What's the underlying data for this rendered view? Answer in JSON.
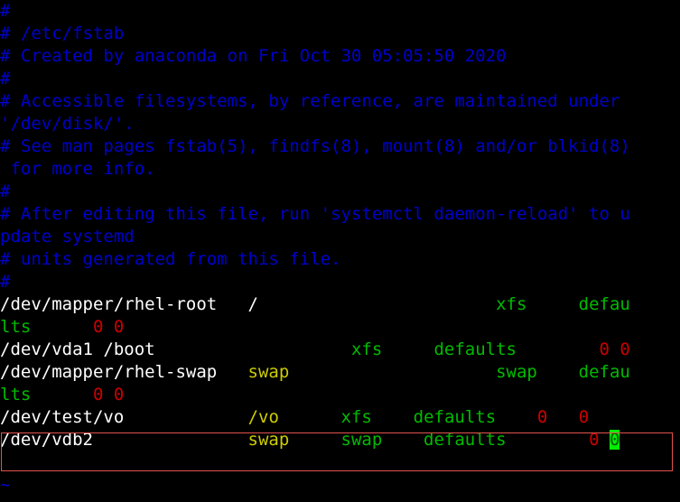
{
  "terminal": {
    "editor": "vim",
    "file": "/etc/fstab",
    "background_color": "#000000",
    "colors": {
      "comment": "#0000cc",
      "device": "#ffffff",
      "mount_point": "#cccc00",
      "fs_type": "#00bb00",
      "options": "#00bb00",
      "numbers": "#cc0000",
      "cursor_background": "#00ee00",
      "selection_border": "#e2524e"
    },
    "lines": [
      {
        "id": "line-1",
        "segments": [
          {
            "text": "#",
            "cls": "c-comment"
          }
        ]
      },
      {
        "id": "line-2",
        "segments": [
          {
            "text": "# /etc/fstab",
            "cls": "c-comment"
          }
        ]
      },
      {
        "id": "line-3",
        "segments": [
          {
            "text": "# Created by anaconda on Fri Oct 30 05:05:50 2020",
            "cls": "c-comment"
          }
        ]
      },
      {
        "id": "line-4",
        "segments": [
          {
            "text": "#",
            "cls": "c-comment"
          }
        ]
      },
      {
        "id": "line-5",
        "segments": [
          {
            "text": "# Accessible filesystems, by reference, are maintained under",
            "cls": "c-comment"
          }
        ]
      },
      {
        "id": "line-6",
        "segments": [
          {
            "text": "'/dev/disk/'.",
            "cls": "c-comment"
          }
        ]
      },
      {
        "id": "line-7",
        "segments": [
          {
            "text": "# See man pages fstab(5), findfs(8), mount(8) and/or blkid(8)",
            "cls": "c-comment"
          }
        ]
      },
      {
        "id": "line-8",
        "segments": [
          {
            "text": " for more info.",
            "cls": "c-comment"
          }
        ]
      },
      {
        "id": "line-9",
        "segments": [
          {
            "text": "#",
            "cls": "c-comment"
          }
        ]
      },
      {
        "id": "line-10",
        "segments": [
          {
            "text": "# After editing this file, run 'systemctl daemon-reload' to u",
            "cls": "c-comment"
          }
        ]
      },
      {
        "id": "line-11",
        "segments": [
          {
            "text": "pdate systemd",
            "cls": "c-comment"
          }
        ]
      },
      {
        "id": "line-12",
        "segments": [
          {
            "text": "# units generated from this file.",
            "cls": "c-comment"
          }
        ]
      },
      {
        "id": "line-13",
        "segments": [
          {
            "text": "#",
            "cls": "c-comment"
          }
        ]
      },
      {
        "id": "line-14",
        "segments": [
          {
            "text": "/dev/mapper/rhel-root",
            "cls": "c-device"
          },
          {
            "text": "   ",
            "cls": "c-device"
          },
          {
            "text": "/",
            "cls": "c-device"
          },
          {
            "text": "                       ",
            "cls": "c-device"
          },
          {
            "text": "xfs",
            "cls": "c-type"
          },
          {
            "text": "     ",
            "cls": "c-type"
          },
          {
            "text": "defau",
            "cls": "c-opts"
          }
        ]
      },
      {
        "id": "line-15",
        "segments": [
          {
            "text": "lts",
            "cls": "c-opts"
          },
          {
            "text": "      ",
            "cls": "c-opts"
          },
          {
            "text": "0 0",
            "cls": "c-num"
          }
        ]
      },
      {
        "id": "line-16",
        "segments": [
          {
            "text": "/dev/vda1 /boot",
            "cls": "c-device"
          },
          {
            "text": "                   ",
            "cls": "c-device"
          },
          {
            "text": "xfs",
            "cls": "c-type"
          },
          {
            "text": "     ",
            "cls": "c-type"
          },
          {
            "text": "defaults",
            "cls": "c-opts"
          },
          {
            "text": "        ",
            "cls": "c-opts"
          },
          {
            "text": "0 0",
            "cls": "c-num"
          }
        ]
      },
      {
        "id": "line-17",
        "segments": [
          {
            "text": "/dev/mapper/rhel-swap",
            "cls": "c-device"
          },
          {
            "text": "   ",
            "cls": "c-device"
          },
          {
            "text": "swap",
            "cls": "c-mount"
          },
          {
            "text": "                    ",
            "cls": "c-mount"
          },
          {
            "text": "swap",
            "cls": "c-type"
          },
          {
            "text": "    ",
            "cls": "c-type"
          },
          {
            "text": "defau",
            "cls": "c-opts"
          }
        ]
      },
      {
        "id": "line-18",
        "segments": [
          {
            "text": "lts",
            "cls": "c-opts"
          },
          {
            "text": "      ",
            "cls": "c-opts"
          },
          {
            "text": "0 0",
            "cls": "c-num"
          }
        ]
      },
      {
        "id": "line-19",
        "segments": [
          {
            "text": "/dev/test/vo",
            "cls": "c-device"
          },
          {
            "text": "            ",
            "cls": "c-device"
          },
          {
            "text": "/vo",
            "cls": "c-mount"
          },
          {
            "text": "      ",
            "cls": "c-mount"
          },
          {
            "text": "xfs",
            "cls": "c-type"
          },
          {
            "text": "    ",
            "cls": "c-type"
          },
          {
            "text": "defaults",
            "cls": "c-opts"
          },
          {
            "text": "    ",
            "cls": "c-opts"
          },
          {
            "text": "0",
            "cls": "c-num"
          },
          {
            "text": "   ",
            "cls": "c-num"
          },
          {
            "text": "0",
            "cls": "c-num"
          }
        ]
      },
      {
        "id": "line-20",
        "segments": [
          {
            "text": "/dev/vdb2",
            "cls": "c-device"
          },
          {
            "text": "               ",
            "cls": "c-device"
          },
          {
            "text": "swap",
            "cls": "c-mount"
          },
          {
            "text": "     ",
            "cls": "c-mount"
          },
          {
            "text": "swap",
            "cls": "c-type"
          },
          {
            "text": "    ",
            "cls": "c-type"
          },
          {
            "text": "defaults",
            "cls": "c-opts"
          },
          {
            "text": "        ",
            "cls": "c-opts"
          },
          {
            "text": "0",
            "cls": "c-num"
          },
          {
            "text": " ",
            "cls": "c-num"
          },
          {
            "text": "0",
            "cls": "cursor"
          }
        ]
      },
      {
        "id": "line-21",
        "segments": [
          {
            "text": "",
            "cls": "c-device"
          }
        ]
      },
      {
        "id": "line-22",
        "segments": [
          {
            "text": "~",
            "cls": "c-tilde"
          }
        ]
      }
    ]
  }
}
